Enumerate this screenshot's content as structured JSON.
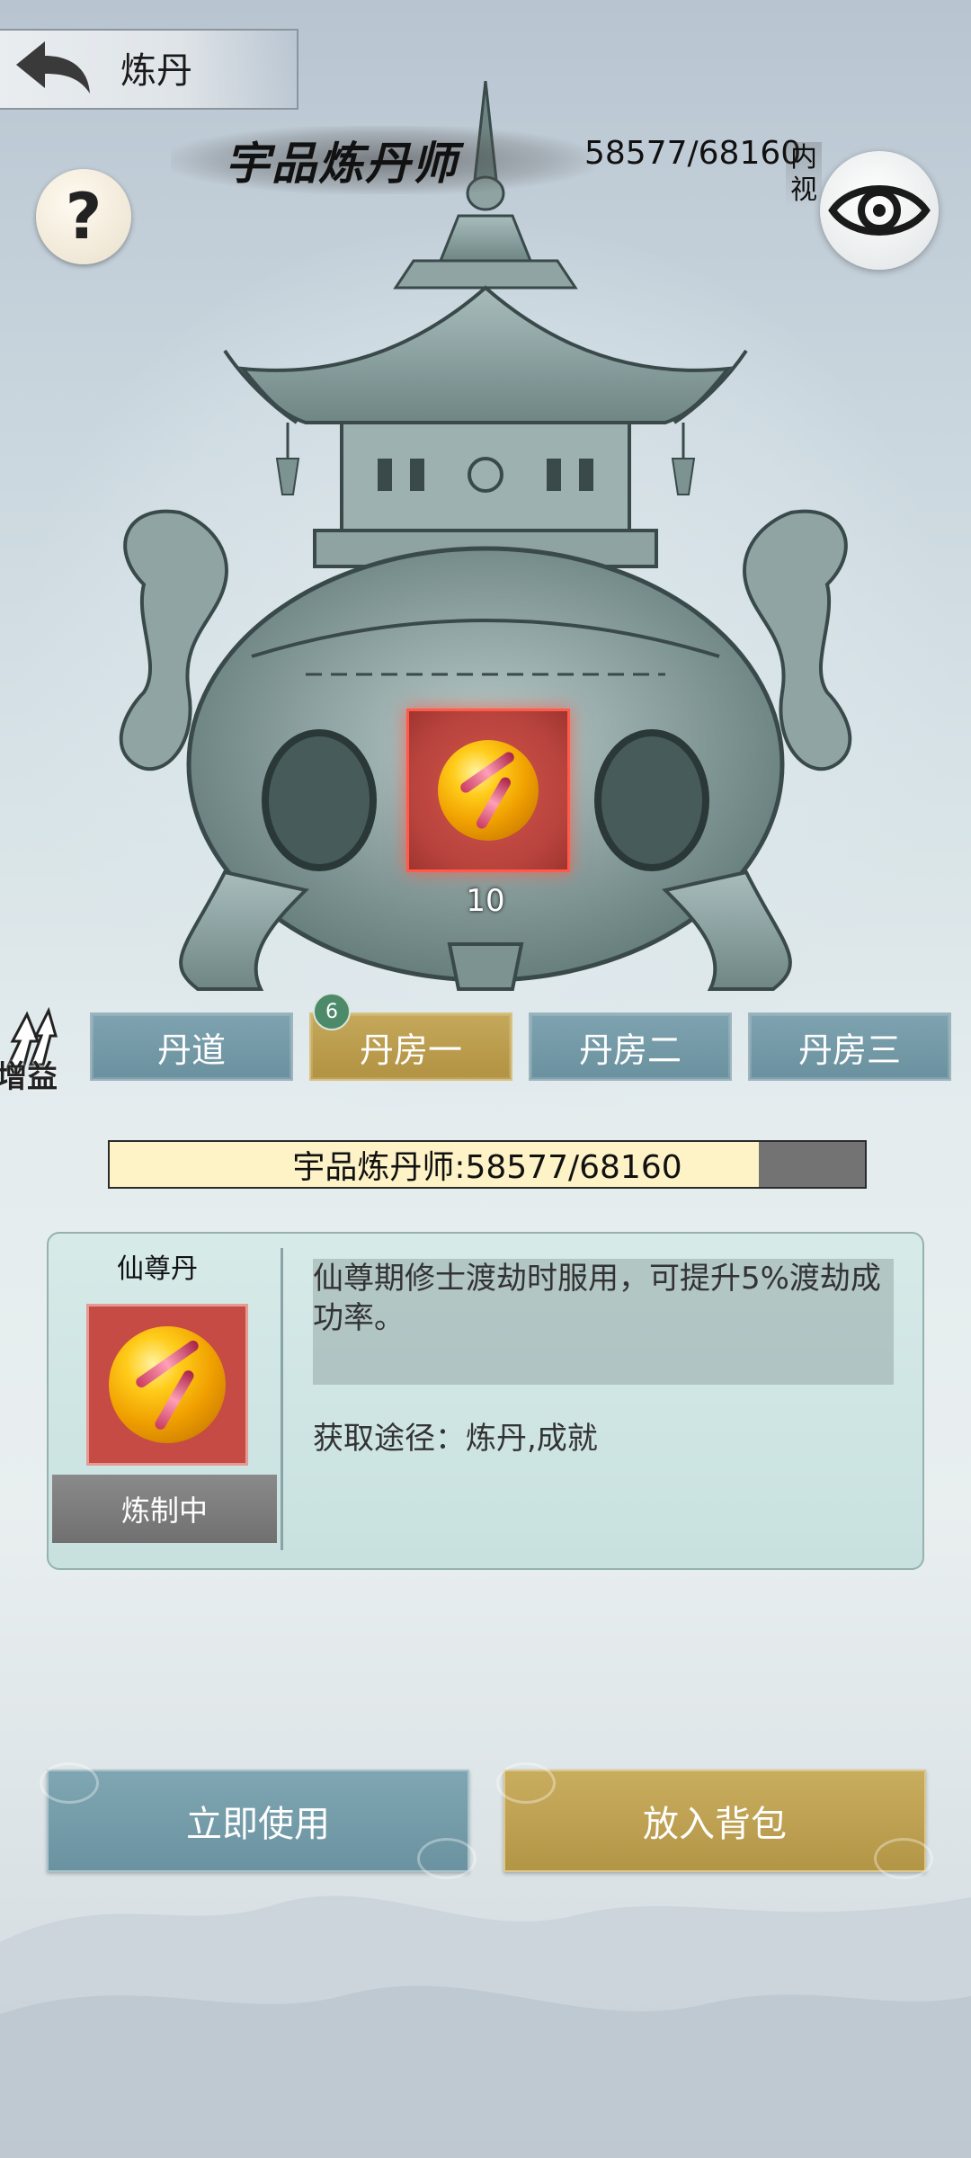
{
  "header": {
    "title": "炼丹",
    "back_icon": "back-arrow-icon"
  },
  "rank": {
    "title": "宇品炼丹师",
    "progress": "58577/68160",
    "inner_view_label": "内视"
  },
  "help": {
    "icon": "question-icon",
    "glyph": "?"
  },
  "cauldron": {
    "slot_count": "10",
    "slot_item": "pill-icon"
  },
  "bonus": {
    "label": "增益",
    "icon": "arrow-up-icon"
  },
  "tabs": [
    {
      "label": "丹道",
      "active": false
    },
    {
      "label": "丹房一",
      "active": true
    },
    {
      "label": "丹房二",
      "active": false
    },
    {
      "label": "丹房三",
      "active": false
    }
  ],
  "tab_badge": "6",
  "exp": {
    "text": "宇品炼丹师:58577/68160",
    "current": 58577,
    "max": 68160
  },
  "item": {
    "name": "仙尊丹",
    "status": "炼制中",
    "description": "仙尊期修士渡劫时服用，可提升5%渡劫成功率。",
    "source": "获取途径：炼丹,成就"
  },
  "buttons": {
    "use": "立即使用",
    "to_bag": "放入背包"
  },
  "colors": {
    "tab_active": "#b29243",
    "tab_normal": "#6a919f",
    "slot_red": "#b8433d",
    "exp_fill": "#fdf3c6"
  }
}
